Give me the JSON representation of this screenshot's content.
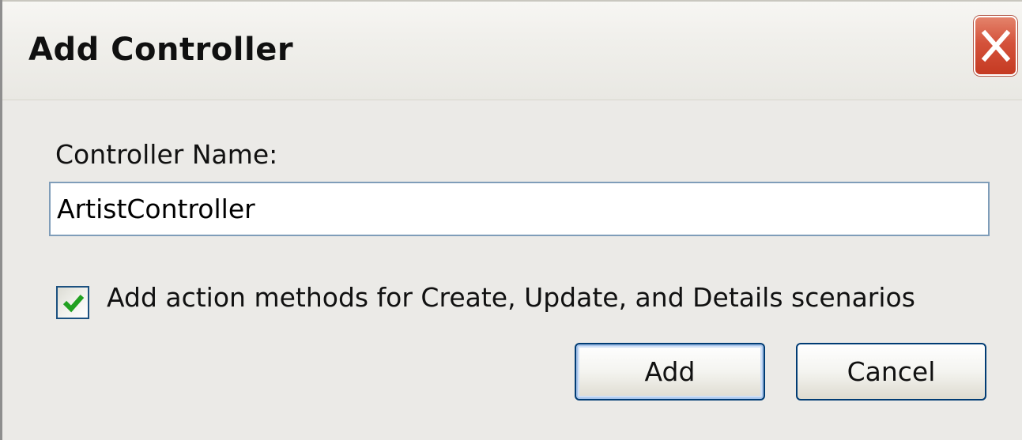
{
  "window": {
    "title": "Add Controller"
  },
  "form": {
    "controller_name_label": "Controller Name:",
    "controller_name_value": "ArtistController",
    "scaffold_checkbox_label": "Add action methods for Create, Update, and Details scenarios",
    "scaffold_checkbox_checked": true
  },
  "buttons": {
    "add_label": "Add",
    "cancel_label": "Cancel"
  },
  "icons": {
    "close": "close-icon",
    "check": "checkmark-icon"
  },
  "colors": {
    "close_button": "#d4523b",
    "checkmark": "#21a121",
    "input_border": "#7f9db9",
    "button_border": "#003c74"
  }
}
